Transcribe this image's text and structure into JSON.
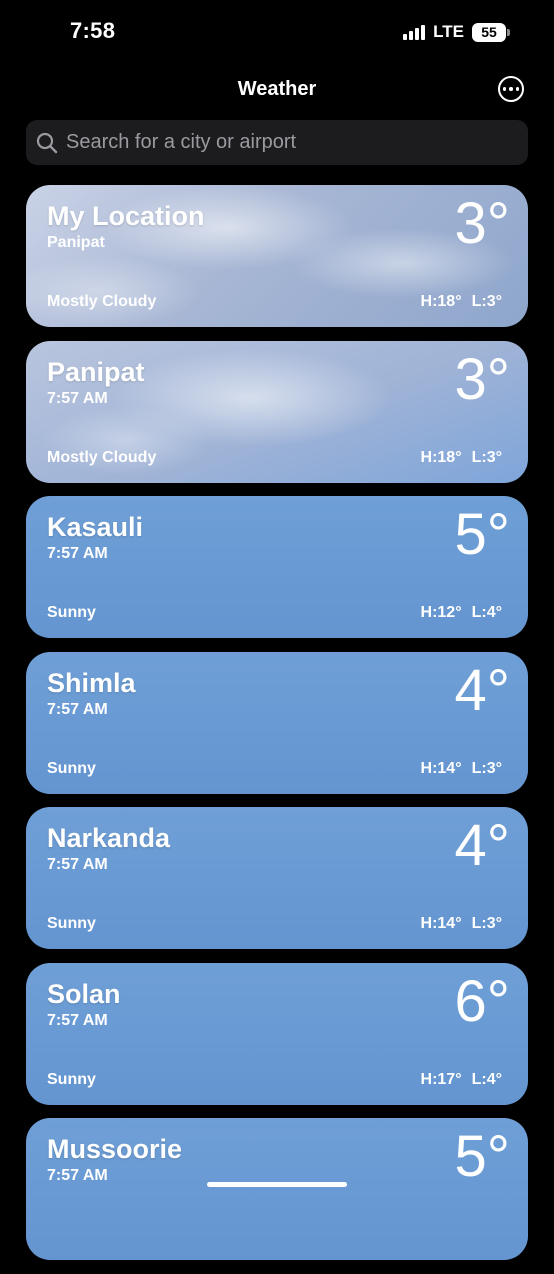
{
  "status_bar": {
    "time": "7:58",
    "network": "LTE",
    "battery": "55"
  },
  "header": {
    "title": "Weather",
    "more_icon": "ellipsis-circle-icon"
  },
  "search": {
    "placeholder": "Search for a city or airport",
    "value": ""
  },
  "locations": [
    {
      "name": "My Location",
      "subtitle": "Panipat",
      "temp": "3°",
      "condition": "Mostly Cloudy",
      "high": "H:18°",
      "low": "L:3°",
      "style": "cloudy"
    },
    {
      "name": "Panipat",
      "subtitle": "7:57 AM",
      "temp": "3°",
      "condition": "Mostly Cloudy",
      "high": "H:18°",
      "low": "L:3°",
      "style": "cloudy2"
    },
    {
      "name": "Kasauli",
      "subtitle": "7:57 AM",
      "temp": "5°",
      "condition": "Sunny",
      "high": "H:12°",
      "low": "L:4°",
      "style": "sunny"
    },
    {
      "name": "Shimla",
      "subtitle": "7:57 AM",
      "temp": "4°",
      "condition": "Sunny",
      "high": "H:14°",
      "low": "L:3°",
      "style": "sunny"
    },
    {
      "name": "Narkanda",
      "subtitle": "7:57 AM",
      "temp": "4°",
      "condition": "Sunny",
      "high": "H:14°",
      "low": "L:3°",
      "style": "sunny"
    },
    {
      "name": "Solan",
      "subtitle": "7:57 AM",
      "temp": "6°",
      "condition": "Sunny",
      "high": "H:17°",
      "low": "L:4°",
      "style": "sunny"
    },
    {
      "name": "Mussoorie",
      "subtitle": "7:57 AM",
      "temp": "5°",
      "style": "sunny"
    }
  ]
}
